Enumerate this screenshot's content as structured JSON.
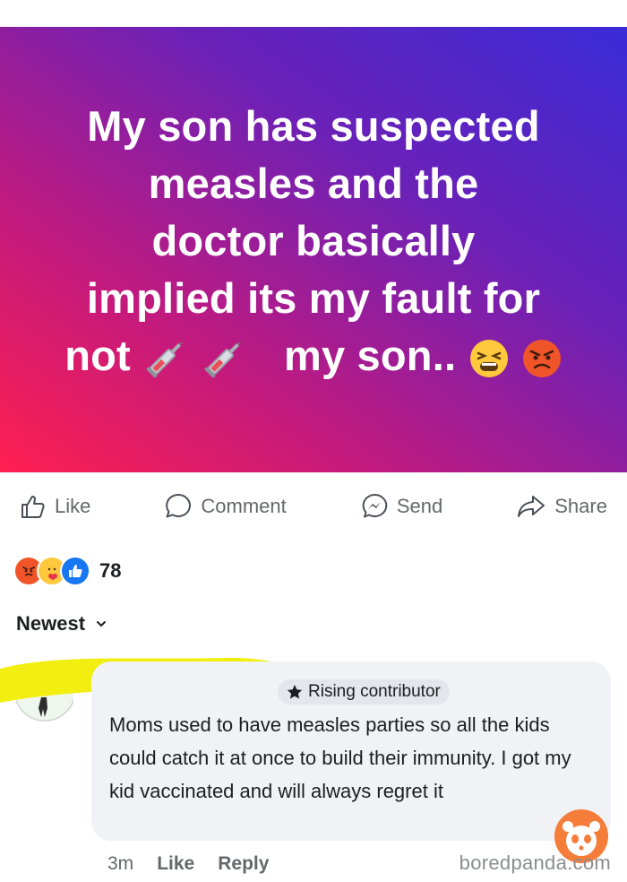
{
  "post": {
    "lines": [
      "My son has suspected",
      "measles and the",
      "doctor basically",
      "implied its my fault for"
    ],
    "last_line_start": "not",
    "last_line_end": "my son.."
  },
  "actions": {
    "like": "Like",
    "comment": "Comment",
    "send": "Send",
    "share": "Share"
  },
  "reactions": {
    "count": "78"
  },
  "sort": {
    "label": "Newest"
  },
  "comment": {
    "badge": "Rising contributor",
    "text": "Moms used to have measles parties so all the kids could catch it at once to build their immunity.  I got my kid vaccinated and will always regret it",
    "time": "3m",
    "like": "Like",
    "reply": "Reply"
  },
  "watermark": "boredpanda.com",
  "colors": {
    "gradient_top_right": "#3a2bd6",
    "gradient_bottom_left": "#ff1f4f",
    "fb_blue": "#1877f2",
    "gray_text": "#65676b",
    "highlighter": "#f2ee10"
  }
}
